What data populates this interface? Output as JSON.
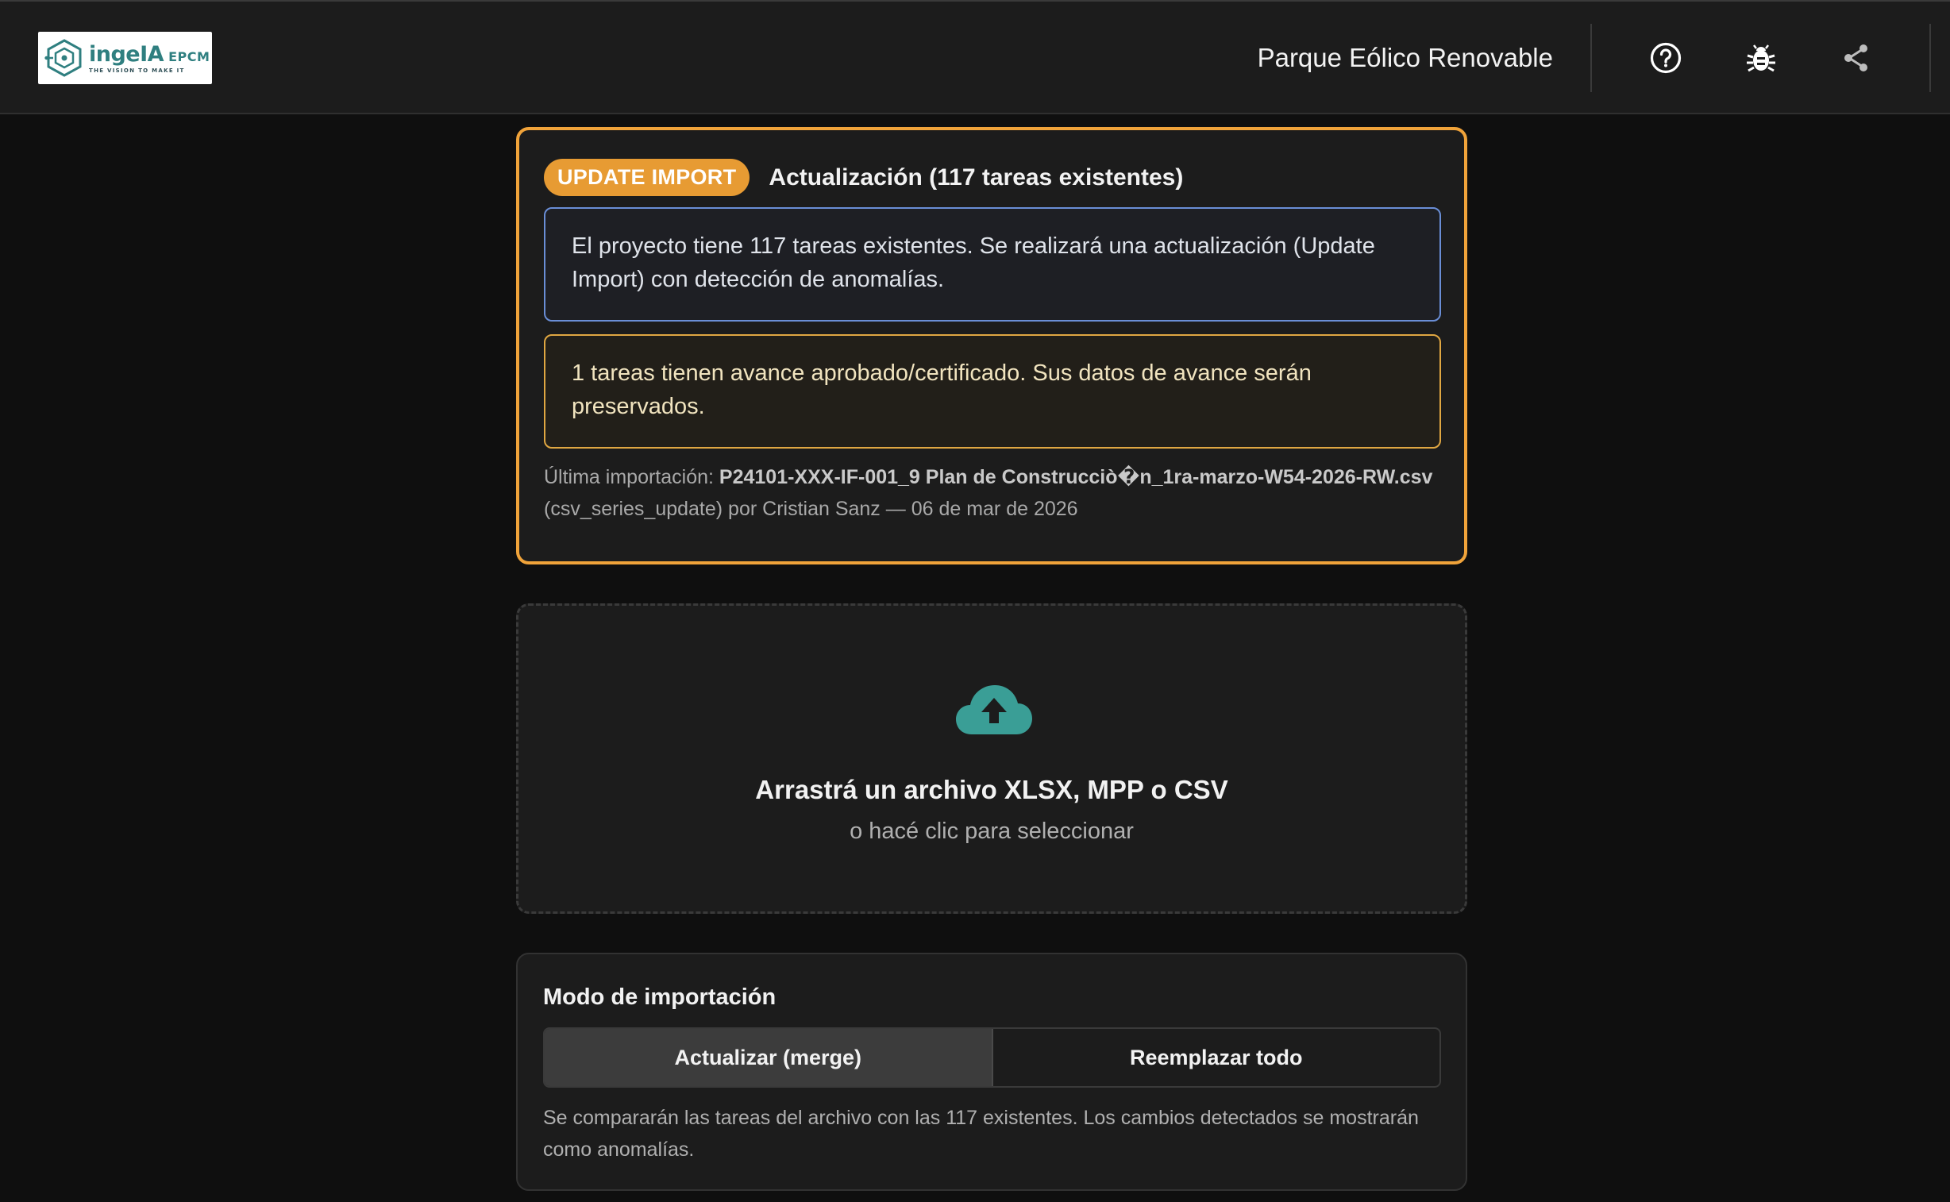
{
  "header": {
    "logo": {
      "name": "ingeIA",
      "suffix": "EPCM",
      "tagline": "THE VISION TO MAKE IT",
      "color": "#2f7f80"
    },
    "project_title": "Parque Eólico Renovable",
    "icons": [
      {
        "name": "help-icon"
      },
      {
        "name": "bug-icon"
      },
      {
        "name": "share-icon"
      }
    ]
  },
  "update_card": {
    "badge": "UPDATE IMPORT",
    "title": "Actualización (117 tareas existentes)",
    "info_message": "El proyecto tiene 117 tareas existentes. Se realizará una actualización (Update Import) con detección de anomalías.",
    "warning_message": "1 tareas tienen avance aprobado/certificado. Sus datos de avance serán preservados.",
    "last_import": {
      "label": "Última importación: ",
      "filename": "P24101-XXX-IF-001_9 Plan de Construcciò�n_1ra-marzo-W54-2026-RW.csv",
      "details": " (csv_series_update) por Cristian Sanz — 06 de mar de 2026"
    },
    "accent_color": "#f0a33a"
  },
  "dropzone": {
    "icon": "cloud-upload-icon",
    "title": "Arrastrá un archivo XLSX, MPP o CSV",
    "subtitle": "o hacé clic para seleccionar",
    "icon_color": "#3a9e96"
  },
  "import_mode": {
    "title": "Modo de importación",
    "options": [
      "Actualizar (merge)",
      "Reemplazar todo"
    ],
    "selected": "Actualizar (merge)",
    "description": "Se compararán las tareas del archivo con las 117 existentes. Los cambios detectados se mostrarán como anomalías."
  }
}
